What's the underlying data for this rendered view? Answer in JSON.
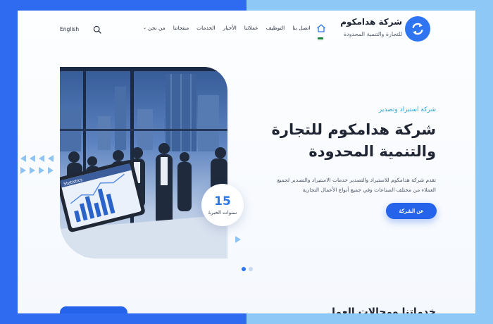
{
  "brand": {
    "title": "شركة هدامكوم",
    "subtitle": "للتجارة والتنمية المحدودة",
    "logo_icon": "refresh-arrows-icon",
    "accent": "#2f74f1"
  },
  "nav": {
    "items": [
      {
        "label": "من نحن",
        "has_dropdown": true
      },
      {
        "label": "منتجاتنا"
      },
      {
        "label": "الخدمات"
      },
      {
        "label": "الأخبار"
      },
      {
        "label": "عملائنا"
      },
      {
        "label": "التوظيف"
      },
      {
        "label": "اتصل بنا"
      }
    ],
    "language": "English"
  },
  "hero": {
    "eyebrow": "شركة استيراد وتصدير",
    "title": "شركة هدامكوم للتجارة والتنمية المحدودة",
    "description": "تقدم شركة هدامكوم للاستيراد والتصدير خدمات الاستيراد والتصدير لجميع العملاء من مختلف الصناعات وفي جميع أنواع الأعمال التجارية",
    "button_label": "عن الشركة",
    "experience_number": "15",
    "experience_label": "سنوات الخبرة",
    "screen_label": "Statistics"
  },
  "slider": {
    "count": 2,
    "active": 1
  },
  "section": {
    "heading": "خدماتنا ومجالات العمل"
  }
}
